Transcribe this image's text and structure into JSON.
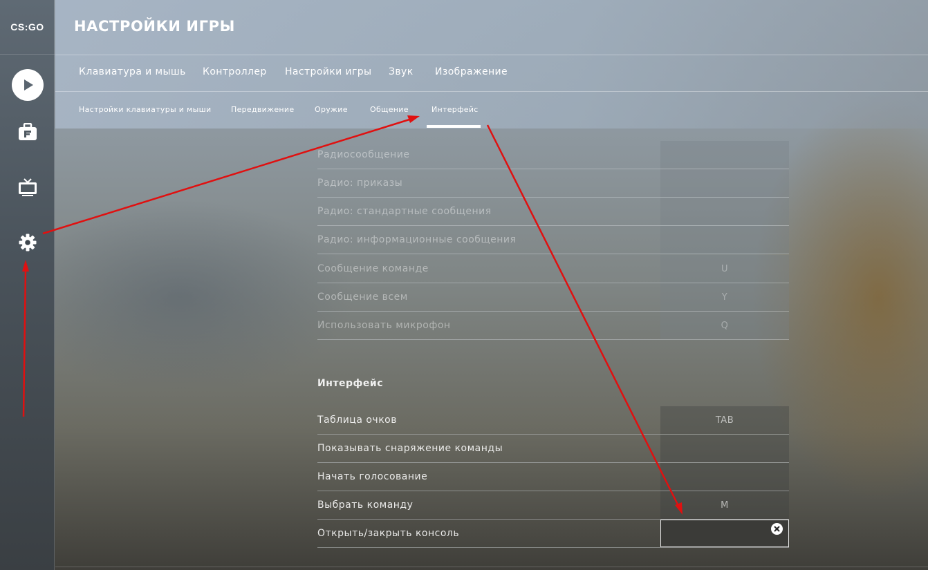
{
  "sidebar": {
    "logo": "CS:GO",
    "buttons": [
      {
        "icon": "play-icon"
      },
      {
        "icon": "briefcase-icon"
      },
      {
        "icon": "tv-icon"
      },
      {
        "icon": "gear-icon"
      }
    ]
  },
  "header": {
    "title": "НАСТРОЙКИ ИГРЫ",
    "main_tabs": [
      "Клавиатура и мышь",
      "Контроллер",
      "Настройки игры",
      "Звук",
      "Изображение"
    ],
    "sub_tabs": [
      "Настройки клавиатуры и мыши",
      "Передвижение",
      "Оружие",
      "Общение",
      "Интерфейс"
    ],
    "active_sub_tab": "Интерфейс"
  },
  "communication_rows": [
    {
      "label": "Радиосообщение",
      "key": ""
    },
    {
      "label": "Радио: приказы",
      "key": ""
    },
    {
      "label": "Радио: стандартные сообщения",
      "key": ""
    },
    {
      "label": "Радио: информационные сообщения",
      "key": ""
    },
    {
      "label": "Сообщение команде",
      "key": "U"
    },
    {
      "label": "Сообщение всем",
      "key": "Y"
    },
    {
      "label": "Использовать микрофон",
      "key": "Q"
    }
  ],
  "interface_section": {
    "title": "Интерфейс",
    "rows": [
      {
        "label": "Таблица очков",
        "key": "TAB"
      },
      {
        "label": "Показывать снаряжение команды",
        "key": ""
      },
      {
        "label": "Начать голосование",
        "key": ""
      },
      {
        "label": "Выбрать команду",
        "key": "M"
      },
      {
        "label": "Открыть/закрыть консоль",
        "key": ""
      }
    ]
  },
  "colors": {
    "annotation_arrow": "#e01010",
    "active_tab_underline": "#ffffff"
  }
}
